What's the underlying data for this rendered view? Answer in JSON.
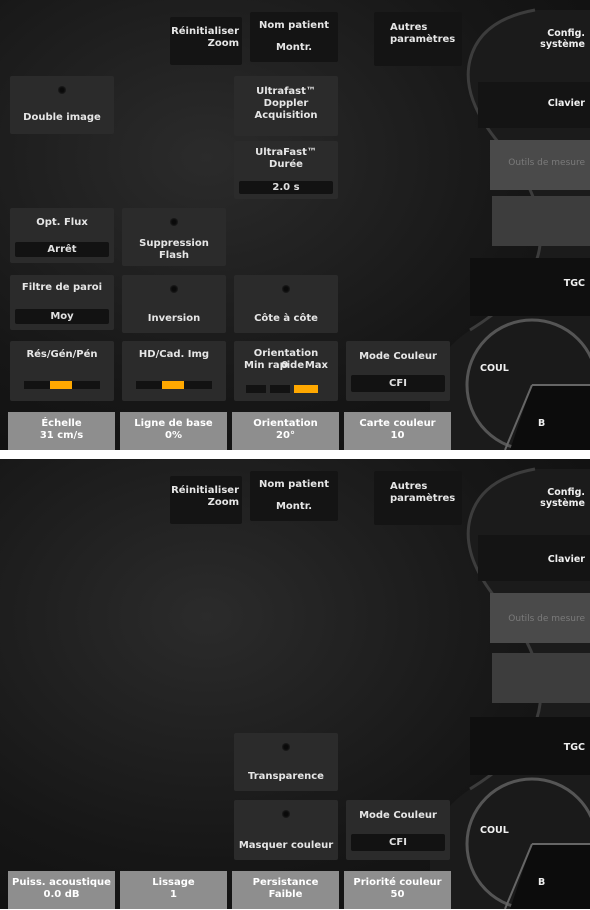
{
  "panel1": {
    "top": {
      "reset_zoom": "Réinitialiser\nZoom",
      "patient_name": "Nom patient",
      "show": "Montr.",
      "other_params": "Autres\nparamètres"
    },
    "right_menu": {
      "config": "Config.\nsystème",
      "keyboard": "Clavier",
      "measure_tools": "Outils de mesure",
      "tgc": "TGC",
      "coul": "COUL",
      "b": "B"
    },
    "controls": {
      "double_image": "Double image",
      "ultrafast_doppler": "Ultrafast™\nDoppler\nAcquisition",
      "ultrafast_duration": "UltraFast™\nDurée",
      "ultrafast_duration_value": "2.0 s",
      "opt_flux": "Opt. Flux",
      "opt_flux_value": "Arrêt",
      "flash_suppression": "Suppression\nFlash",
      "wall_filter": "Filtre de paroi",
      "wall_filter_value": "Moy",
      "inversion": "Inversion",
      "side_by_side": "Côte à côte",
      "res_gen_pen": "Rés/Gén/Pén",
      "hd_frame": "HD/Cad. Img",
      "quick_orientation": "Orientation rapide",
      "quick_orientation_min": "Min",
      "quick_orientation_mid": "0",
      "quick_orientation_max": "Max",
      "color_mode": "Mode Couleur",
      "color_mode_value": "CFI"
    },
    "bottom": [
      {
        "label": "Échelle",
        "value": "31 cm/s"
      },
      {
        "label": "Ligne de base",
        "value": "0%"
      },
      {
        "label": "Orientation",
        "value": "20°"
      },
      {
        "label": "Carte couleur",
        "value": "10"
      }
    ]
  },
  "panel2": {
    "top": {
      "reset_zoom": "Réinitialiser\nZoom",
      "patient_name": "Nom patient",
      "show": "Montr.",
      "other_params": "Autres\nparamètres"
    },
    "right_menu": {
      "config": "Config.\nsystème",
      "keyboard": "Clavier",
      "measure_tools": "Outils de mesure",
      "tgc": "TGC",
      "coul": "COUL",
      "b": "B"
    },
    "controls": {
      "transparency": "Transparence",
      "hide_color": "Masquer couleur",
      "color_mode": "Mode Couleur",
      "color_mode_value": "CFI"
    },
    "bottom": [
      {
        "label": "Puiss. acoustique",
        "value": "0.0 dB"
      },
      {
        "label": "Lissage",
        "value": "1"
      },
      {
        "label": "Persistance",
        "value": "Faible"
      },
      {
        "label": "Priorité couleur",
        "value": "50"
      }
    ]
  },
  "colors": {
    "accent": "#ffa800",
    "button": "#2b2b2b",
    "bottom_button": "#8e8e8e",
    "disabled_text": "#7a7a7a"
  }
}
